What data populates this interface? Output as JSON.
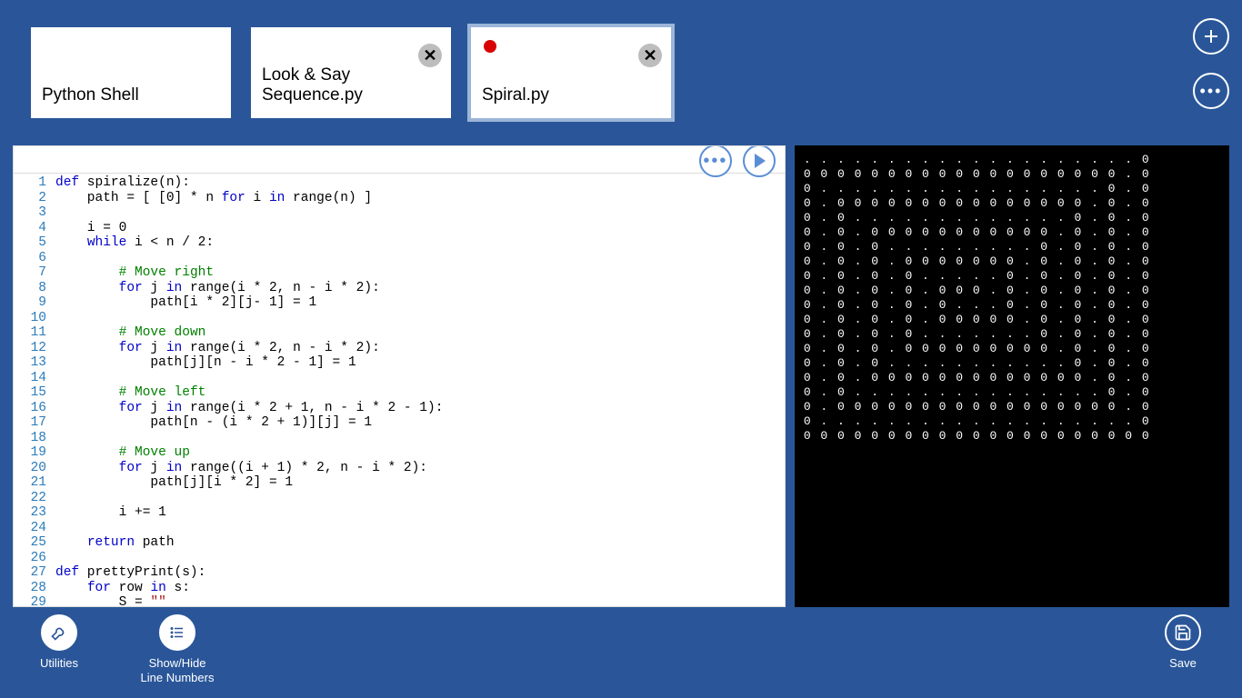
{
  "tabs": [
    {
      "label": "Python Shell",
      "has_close": false,
      "unsaved": false,
      "active": false
    },
    {
      "label": "Look & Say Sequence.py",
      "has_close": true,
      "unsaved": false,
      "active": false
    },
    {
      "label": "Spiral.py",
      "has_close": true,
      "unsaved": true,
      "active": true
    }
  ],
  "code_lines": [
    {
      "n": 1,
      "html": "<span class='kw'>def</span> spiralize(n):"
    },
    {
      "n": 2,
      "html": "    path = [ [0] * n <span class='kw'>for</span> i <span class='kw'>in</span> range(n) ]"
    },
    {
      "n": 3,
      "html": ""
    },
    {
      "n": 4,
      "html": "    i = 0"
    },
    {
      "n": 5,
      "html": "    <span class='kw'>while</span> i &lt; n / 2:"
    },
    {
      "n": 6,
      "html": ""
    },
    {
      "n": 7,
      "html": "        <span class='cm'># Move right</span>"
    },
    {
      "n": 8,
      "html": "        <span class='kw'>for</span> j <span class='kw'>in</span> range(i * 2, n - i * 2):"
    },
    {
      "n": 9,
      "html": "            path[i * 2][j- 1] = 1"
    },
    {
      "n": 10,
      "html": ""
    },
    {
      "n": 11,
      "html": "        <span class='cm'># Move down</span>"
    },
    {
      "n": 12,
      "html": "        <span class='kw'>for</span> j <span class='kw'>in</span> range(i * 2, n - i * 2):"
    },
    {
      "n": 13,
      "html": "            path[j][n - i * 2 - 1] = 1"
    },
    {
      "n": 14,
      "html": ""
    },
    {
      "n": 15,
      "html": "        <span class='cm'># Move left</span>"
    },
    {
      "n": 16,
      "html": "        <span class='kw'>for</span> j <span class='kw'>in</span> range(i * 2 + 1, n - i * 2 - 1):"
    },
    {
      "n": 17,
      "html": "            path[n - (i * 2 + 1)][j] = 1"
    },
    {
      "n": 18,
      "html": ""
    },
    {
      "n": 19,
      "html": "        <span class='cm'># Move up</span>"
    },
    {
      "n": 20,
      "html": "        <span class='kw'>for</span> j <span class='kw'>in</span> range((i + 1) * 2, n - i * 2):"
    },
    {
      "n": 21,
      "html": "            path[j][i * 2] = 1"
    },
    {
      "n": 22,
      "html": ""
    },
    {
      "n": 23,
      "html": "        i += 1"
    },
    {
      "n": 24,
      "html": ""
    },
    {
      "n": 25,
      "html": "    <span class='kw'>return</span> path"
    },
    {
      "n": 26,
      "html": ""
    },
    {
      "n": 27,
      "html": "<span class='kw'>def</span> prettyPrint(s):"
    },
    {
      "n": 28,
      "html": "    <span class='kw'>for</span> row <span class='kw'>in</span> s:"
    },
    {
      "n": 29,
      "html": "        S = <span class='str'>\"\"</span>"
    }
  ],
  "output_lines": [
    ". . . . . . . . . . . . . . . . . . . . 0",
    "0 0 0 0 0 0 0 0 0 0 0 0 0 0 0 0 0 0 0 . 0",
    "0 . . . . . . . . . . . . . . . . . 0 . 0",
    "0 . 0 0 0 0 0 0 0 0 0 0 0 0 0 0 0 . 0 . 0",
    "0 . 0 . . . . . . . . . . . . . 0 . 0 . 0",
    "0 . 0 . 0 0 0 0 0 0 0 0 0 0 0 . 0 . 0 . 0",
    "0 . 0 . 0 . . . . . . . . . 0 . 0 . 0 . 0",
    "0 . 0 . 0 . 0 0 0 0 0 0 0 . 0 . 0 . 0 . 0",
    "0 . 0 . 0 . 0 . . . . . 0 . 0 . 0 . 0 . 0",
    "0 . 0 . 0 . 0 . 0 0 0 . 0 . 0 . 0 . 0 . 0",
    "0 . 0 . 0 . 0 . 0 . . . 0 . 0 . 0 . 0 . 0",
    "0 . 0 . 0 . 0 . 0 0 0 0 0 . 0 . 0 . 0 . 0",
    "0 . 0 . 0 . 0 . . . . . . . 0 . 0 . 0 . 0",
    "0 . 0 . 0 . 0 0 0 0 0 0 0 0 0 . 0 . 0 . 0",
    "0 . 0 . 0 . . . . . . . . . . . 0 . 0 . 0",
    "0 . 0 . 0 0 0 0 0 0 0 0 0 0 0 0 0 . 0 . 0",
    "0 . 0 . . . . . . . . . . . . . . . 0 . 0",
    "0 . 0 0 0 0 0 0 0 0 0 0 0 0 0 0 0 0 0 . 0",
    "0 . . . . . . . . . . . . . . . . . . . 0",
    "0 0 0 0 0 0 0 0 0 0 0 0 0 0 0 0 0 0 0 0 0"
  ],
  "appbar": {
    "utilities": "Utilities",
    "line_numbers": "Show/Hide Line Numbers",
    "save": "Save"
  }
}
